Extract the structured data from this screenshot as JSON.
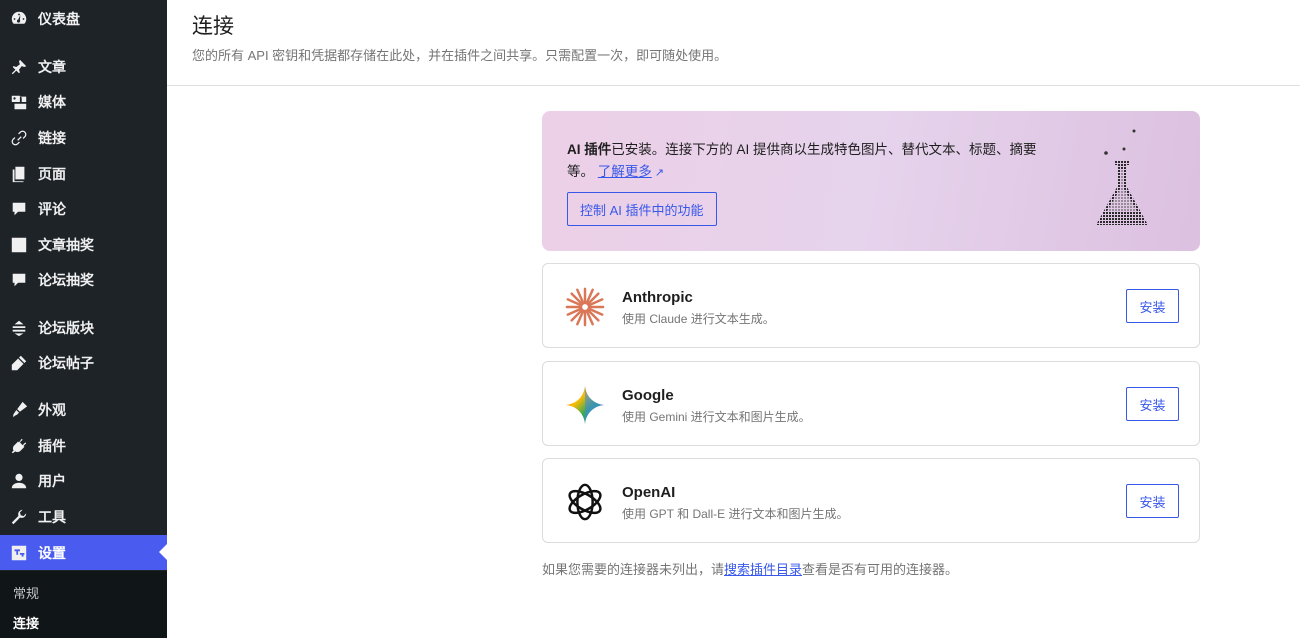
{
  "sidebar": {
    "items": [
      {
        "label": "仪表盘",
        "icon": "dashboard-icon"
      },
      {
        "label": "文章",
        "icon": "pin-icon"
      },
      {
        "label": "媒体",
        "icon": "media-icon"
      },
      {
        "label": "链接",
        "icon": "link-icon"
      },
      {
        "label": "页面",
        "icon": "page-icon"
      },
      {
        "label": "评论",
        "icon": "comment-icon"
      },
      {
        "label": "文章抽奖",
        "icon": "post-lottery-icon"
      },
      {
        "label": "论坛抽奖",
        "icon": "forum-lottery-icon"
      },
      {
        "label": "论坛版块",
        "icon": "forum-board-icon"
      },
      {
        "label": "论坛帖子",
        "icon": "forum-post-icon"
      },
      {
        "label": "外观",
        "icon": "brush-icon"
      },
      {
        "label": "插件",
        "icon": "plugin-icon"
      },
      {
        "label": "用户",
        "icon": "user-icon"
      },
      {
        "label": "工具",
        "icon": "wrench-icon"
      },
      {
        "label": "设置",
        "icon": "settings-icon"
      }
    ],
    "submenu": [
      {
        "label": "常规"
      },
      {
        "label": "连接"
      }
    ],
    "accent_color": "#4a5cf0"
  },
  "header": {
    "title": "连接",
    "subtitle": "您的所有 API 密钥和凭据都存储在此处，并在插件之间共享。只需配置一次，即可随处使用。"
  },
  "banner": {
    "bold": "AI 插件",
    "text": "已安装。连接下方的 AI 提供商以生成特色图片、替代文本、标题、摘要等。",
    "link": "了解更多",
    "button": "控制 AI 插件中的功能"
  },
  "connectors": [
    {
      "name": "Anthropic",
      "desc": "使用 Claude 进行文本生成。",
      "button": "安装",
      "icon": "anthropic-icon"
    },
    {
      "name": "Google",
      "desc": "使用 Gemini 进行文本和图片生成。",
      "button": "安装",
      "icon": "gemini-icon"
    },
    {
      "name": "OpenAI",
      "desc": "使用 GPT 和 Dall-E 进行文本和图片生成。",
      "button": "安装",
      "icon": "openai-icon"
    }
  ],
  "footer": {
    "before": "如果您需要的连接器未列出，请",
    "link": "搜索插件目录",
    "after": "查看是否有可用的连接器。"
  }
}
